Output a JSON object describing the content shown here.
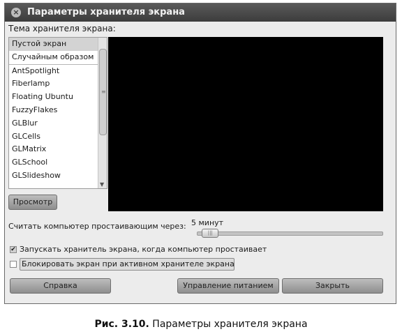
{
  "window": {
    "title": "Параметры хранителя экрана"
  },
  "themes": {
    "label": "Тема хранителя экрана:",
    "items": [
      "Пустой экран",
      "Случайным образом",
      "AntSpotlight",
      "Fiberlamp",
      "Floating Ubuntu",
      "FuzzyFlakes",
      "GLBlur",
      "GLCells",
      "GLMatrix",
      "GLSchool",
      "GLSlideshow"
    ],
    "selected": "Пустой экран"
  },
  "preview_button": "Просмотр",
  "idle": {
    "label": "Считать компьютер простаивающим через:",
    "value": "5 минут",
    "slider_fraction": 0.03
  },
  "options": {
    "activate_label": "Запускать хранитель экрана, когда компьютер простаивает",
    "activate_checked": true,
    "lock_label": "Блокировать экран при активном хранителе экрана",
    "lock_checked": false
  },
  "buttons": {
    "help": "Справка",
    "power": "Управление питанием",
    "close": "Закрыть"
  },
  "caption": {
    "prefix": "Рис. 3.10.",
    "text": " Параметры хранителя экрана"
  }
}
